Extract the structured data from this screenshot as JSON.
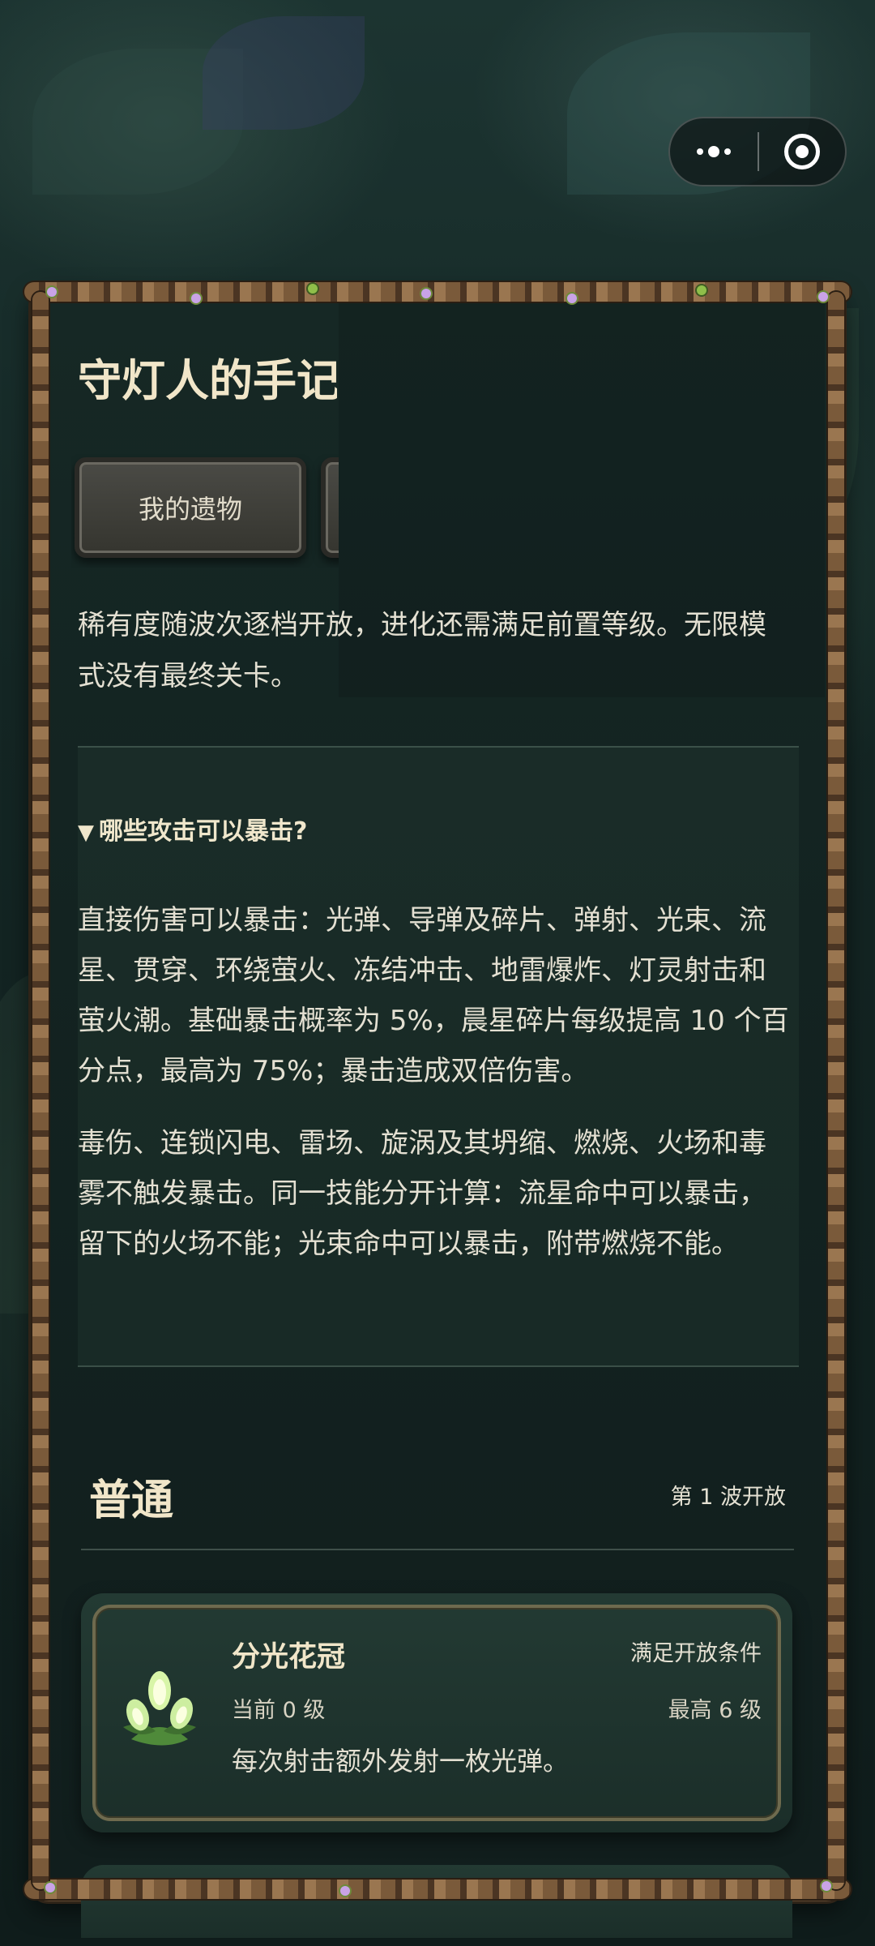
{
  "capsule": {
    "more_icon": "more-dots-icon",
    "close_icon": "target-circle-icon"
  },
  "page": {
    "title": "守灯人的手记"
  },
  "tabs": [
    {
      "label": "我的遗物"
    },
    {
      "label": ""
    }
  ],
  "description": "稀有度随波次逐档开放，进化还需满足前置等级。无限模式没有最终关卡。",
  "faq": {
    "question": "哪些攻击可以暴击?",
    "answer_1": "直接伤害可以暴击：光弹、导弹及碎片、弹射、光束、流星、贯穿、环绕萤火、冻结冲击、地雷爆炸、灯灵射击和萤火潮。基础暴击概率为 5%，晨星碎片每级提高 10 个百分点，最高为 75%；暴击造成双倍伤害。",
    "answer_2": "毒伤、连锁闪电、雷场、旋涡及其坍缩、燃烧、火场和毒雾不触发暴击。同一技能分开计算：流星命中可以暴击，留下的火场不能；光束命中可以暴击，附带燃烧不能。"
  },
  "section": {
    "title": "普通",
    "unlock": "第 1 波开放"
  },
  "relic_card": {
    "name": "分光花冠",
    "condition": "满足开放条件",
    "current_level": "当前 0 级",
    "max_level": "最高 6 级",
    "description": "每次射击额外发射一枚光弹。",
    "icon": "glowing-bud-icon"
  },
  "colors": {
    "title": "#f1e6c9",
    "text": "#e4e0d2",
    "frame_wood": "#5d4630",
    "card_bg": "#233a33"
  }
}
